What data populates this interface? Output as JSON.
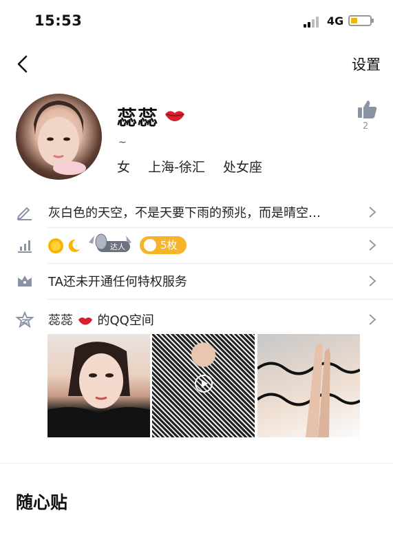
{
  "status": {
    "time": "15:53",
    "network": "4G"
  },
  "nav": {
    "settings_label": "设置"
  },
  "profile": {
    "name": "蕊蕊",
    "tilde": "~",
    "gender": "女",
    "location": "上海-徐汇",
    "zodiac": "处女座",
    "like_count": "2"
  },
  "rows": {
    "signature": "灰白色的天空，不是天要下雨的预兆，而是晴空…",
    "badges": {
      "daren_label": "达人",
      "coins_label": "5枚"
    },
    "privilege": "TA还未开通任何特权服务",
    "qzone": {
      "name": "蕊蕊",
      "suffix": "的QQ空间"
    }
  },
  "section": {
    "title": "随心贴"
  },
  "colors": {
    "accent": "#f5b429",
    "icon_gray": "#8a93a6"
  }
}
